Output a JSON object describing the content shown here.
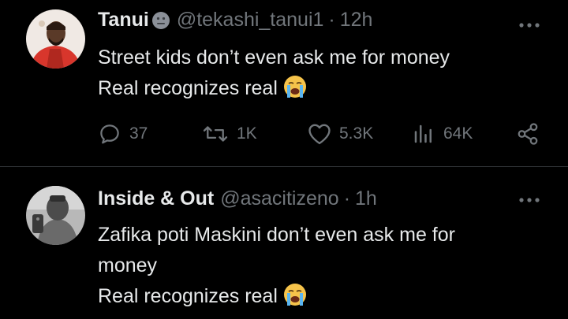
{
  "tweets": [
    {
      "name": "Tanui",
      "handle": "@tekashi_tanui1",
      "separator": "·",
      "time": "12h",
      "lines": [
        "Street kids don’t even ask me for money",
        "Real recognizes real"
      ],
      "actions": {
        "replies": "37",
        "retweets": "1K",
        "likes": "5.3K",
        "views": "64K"
      },
      "avatar_color": "#d8362c"
    },
    {
      "name": "Inside & Out",
      "handle": "@asacitizeno",
      "separator": "·",
      "time": "1h",
      "lines": [
        "Zafika poti Maskini don’t even ask me for",
        "money",
        "Real recognizes real"
      ],
      "avatar_color": "#8d8d8d"
    }
  ],
  "icons": {
    "more": "more-horizontal-icon",
    "reply": "reply-icon",
    "retweet": "retweet-icon",
    "like": "heart-icon",
    "views": "views-icon",
    "share": "share-icon",
    "crying": "loudly-crying-face-emoji",
    "face": "neutral-face-emoji"
  },
  "colors": {
    "background": "#000000",
    "text": "#e7e9ea",
    "secondary": "#71767b",
    "divider": "#2f3336"
  }
}
